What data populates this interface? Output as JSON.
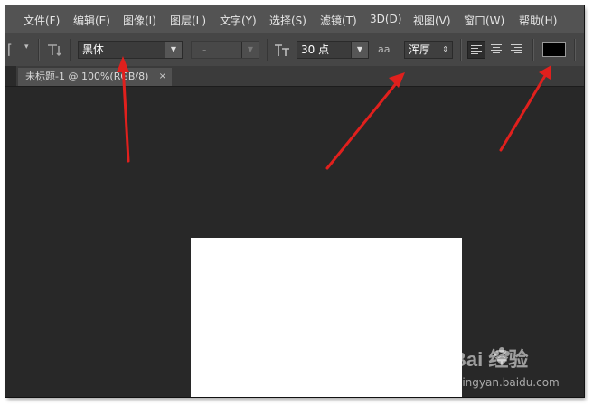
{
  "menubar": {
    "items": [
      "文件(F)",
      "编辑(E)",
      "图像(I)",
      "图层(L)",
      "文字(Y)",
      "选择(S)",
      "滤镜(T)",
      "3D(D)",
      "视图(V)",
      "窗口(W)",
      "帮助(H)"
    ]
  },
  "options": {
    "font_family": "黑体",
    "font_style": "-",
    "font_size": "30 点",
    "antialias_label": "aa",
    "antialias": "浑厚",
    "text_color": "#000000"
  },
  "document_tab": {
    "title": "未标题-1 @ 100%(RGB/8)",
    "close": "×"
  },
  "watermark": {
    "brand": "Bai  经验",
    "url": "jingyan.baidu.com"
  },
  "colors": {
    "arrow": "#e0201d",
    "menubar": "#535353",
    "optionsbar": "#464646",
    "workspace": "#282828"
  }
}
